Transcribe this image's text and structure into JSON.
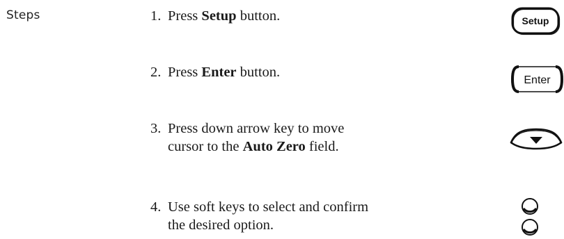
{
  "section_label": "Steps",
  "steps": [
    {
      "number": "1.",
      "pre": "Press ",
      "bold": "Setup",
      "post": " button.",
      "icon": "setup-key-icon",
      "key_label": "Setup"
    },
    {
      "number": "2.",
      "pre": "Press ",
      "bold": "Enter",
      "post": " button.",
      "icon": "enter-key-icon",
      "key_label": "Enter"
    },
    {
      "number": "3.",
      "line1": "Press down arrow key to move",
      "line2_pre": "cursor to the ",
      "bold": "Auto Zero",
      "line2_post": " field.",
      "icon": "down-arrow-key-icon"
    },
    {
      "number": "4.",
      "line1": "Use soft keys to select and confirm",
      "line2": "the desired option.",
      "icon": "soft-keys-icon"
    }
  ]
}
